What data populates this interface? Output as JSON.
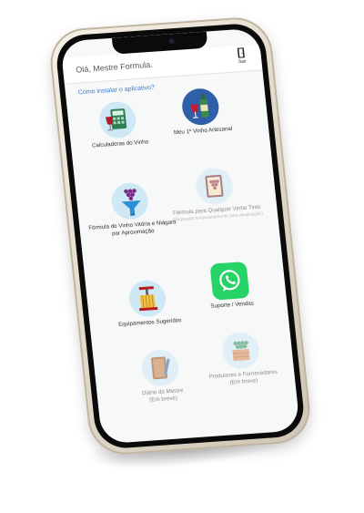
{
  "header": {
    "greeting": "Olá, Mestre Formula.",
    "exit_label": "Sair"
  },
  "install_link": "Como instalar o aplicativo?",
  "tiles": [
    {
      "label": "Calculadoras do Vinho",
      "icon": "calculator-wine-icon",
      "status": ""
    },
    {
      "label": "Meu 1º Vinho Artesanal",
      "icon": "wine-bottle-icon",
      "status": ""
    },
    {
      "label": "Fórmula do Vinho Vitória e Niágara por Aproximação",
      "icon": "funnel-grapes-icon",
      "status": ""
    },
    {
      "label": "Fórmula para Qualquer Vinho Tinto",
      "icon": "grape-book-icon",
      "status": "(bloqueado temporariamente para atualização)"
    },
    {
      "label": "Equipamentos Sugeridos",
      "icon": "wine-press-icon",
      "status": ""
    },
    {
      "label": "Suporte / Vendas",
      "icon": "whatsapp-icon",
      "status": ""
    },
    {
      "label": "Diário do Mestre",
      "icon": "notebook-pen-icon",
      "status": "(Em breve)"
    },
    {
      "label": "Produtores e Fornecedores",
      "icon": "grape-crate-icon",
      "status": "(Em breve)"
    }
  ],
  "colors": {
    "link": "#3e7bd6",
    "whatsapp": "#25d366",
    "icon_bg": "#cfe8f6"
  }
}
